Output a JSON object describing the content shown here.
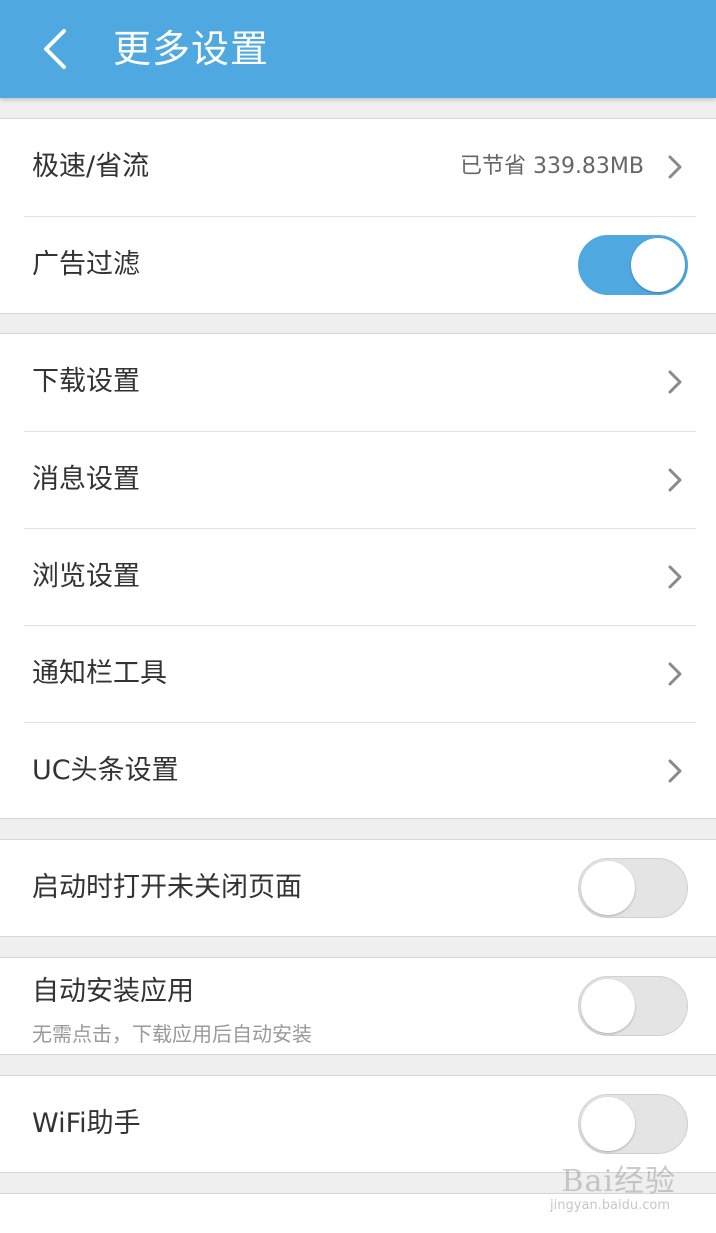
{
  "header": {
    "title": "更多设置",
    "back_icon": "chevron-left-icon",
    "background": "#4fa8e0"
  },
  "groups": {
    "speed": {
      "label": "极速/省流",
      "value": "已节省 339.83MB"
    },
    "adblock": {
      "label": "广告过滤",
      "toggle_on": true
    },
    "download": {
      "label": "下载设置"
    },
    "message": {
      "label": "消息设置"
    },
    "browse": {
      "label": "浏览设置"
    },
    "notifybar": {
      "label": "通知栏工具"
    },
    "ucnews": {
      "label": "UC头条设置"
    },
    "restore": {
      "label": "启动时打开未关闭页面",
      "toggle_on": false
    },
    "autoinstall": {
      "label": "自动安装应用",
      "sub": "无需点击，下载应用后自动安装",
      "toggle_on": false
    },
    "wifi": {
      "label": "WiFi助手",
      "toggle_on": false
    }
  },
  "watermark": {
    "brand": "Bai经验",
    "url": "jingyan.baidu.com"
  },
  "colors": {
    "accent": "#4fa8e0",
    "toggle_off": "#e4e4e4"
  }
}
